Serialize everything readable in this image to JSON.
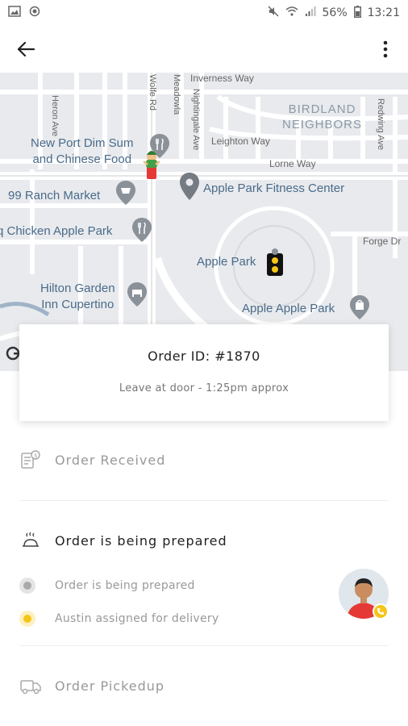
{
  "status_bar": {
    "battery": "56%",
    "time": "13:21"
  },
  "map": {
    "roads": {
      "inverness": "Inverness Way",
      "leighton": "Leighton Way",
      "lorne": "Lorne Way",
      "forge": "Forge Dr",
      "heron": "Heron Ave",
      "nightingale": "Nightingale Ave",
      "meadowlark": "Meadowla",
      "wolfe": "Wolfe Rd",
      "redwing": "Redwing Ave"
    },
    "district": "BIRDLAND\nNEIGHBORS",
    "places": {
      "dimsum": "New Port Dim Sum\nand Chinese Food",
      "ranch": "99 Ranch Market",
      "fitness": "Apple Park Fitness Center",
      "chicken": "q Chicken Apple Park",
      "apple_park": "Apple Park",
      "hilton": "Hilton Garden\nInn Cupertino",
      "apple_apple": "Apple Apple Park"
    }
  },
  "order": {
    "id_label": "Order ID: #1870",
    "note": "Leave at door - 1:25pm approx"
  },
  "timeline": {
    "received": "Order Received",
    "preparing": "Order is being prepared",
    "sub_preparing": "Order is being prepared",
    "sub_assigned": "Austin assigned for delivery",
    "pickedup": "Order Pickedup"
  },
  "colors": {
    "accent": "#f5c518",
    "muted": "#999999"
  }
}
